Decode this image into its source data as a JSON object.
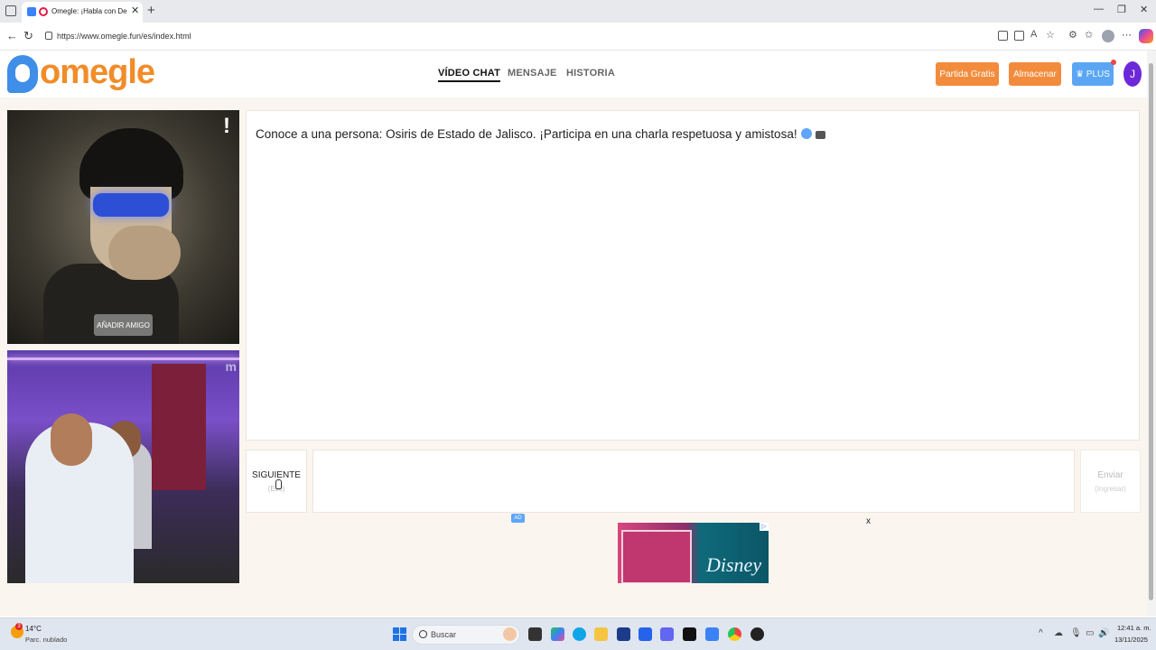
{
  "browser": {
    "tab_title": "Omegle: ¡Habla con Descon",
    "url": "https://www.omegle.fun/es/index.html"
  },
  "site": {
    "logo_text": "omegle",
    "nav": [
      {
        "label": "VÍDEO CHAT",
        "active": true
      },
      {
        "label": "MENSAJE",
        "active": false
      },
      {
        "label": "HISTORIA",
        "active": false
      }
    ],
    "buttons": {
      "partida": "Partida Gratis",
      "almacenar": "Almacenar",
      "plus": "♛ PLUS"
    },
    "avatar_initial": "J"
  },
  "video": {
    "stranger_flag": "!",
    "add_friend": "AÑADIR AMIGO",
    "watermark": "m"
  },
  "chat": {
    "message": "Conoce a una persona: Osiris de Estado de Jalisco. ¡Participa en una charla respetuosa y amistosa!",
    "next_label": "SIGUIENTE",
    "next_hint": "(Esc)",
    "send_label": "Enviar",
    "send_hint": "(Ingresar)"
  },
  "ad": {
    "label": "AD",
    "close": "x",
    "banner_text": "Disney"
  },
  "taskbar": {
    "temperature": "14°C",
    "weather": "Parc. nublado",
    "weather_badge": "3",
    "search_placeholder": "Buscar",
    "time": "12:41 a. m.",
    "date": "13/11/2025"
  },
  "colors": {
    "brand_orange": "#f28c28",
    "brand_blue": "#3f8ee8",
    "plus_blue": "#5aa6f5",
    "avatar_purple": "#6d28d9"
  }
}
